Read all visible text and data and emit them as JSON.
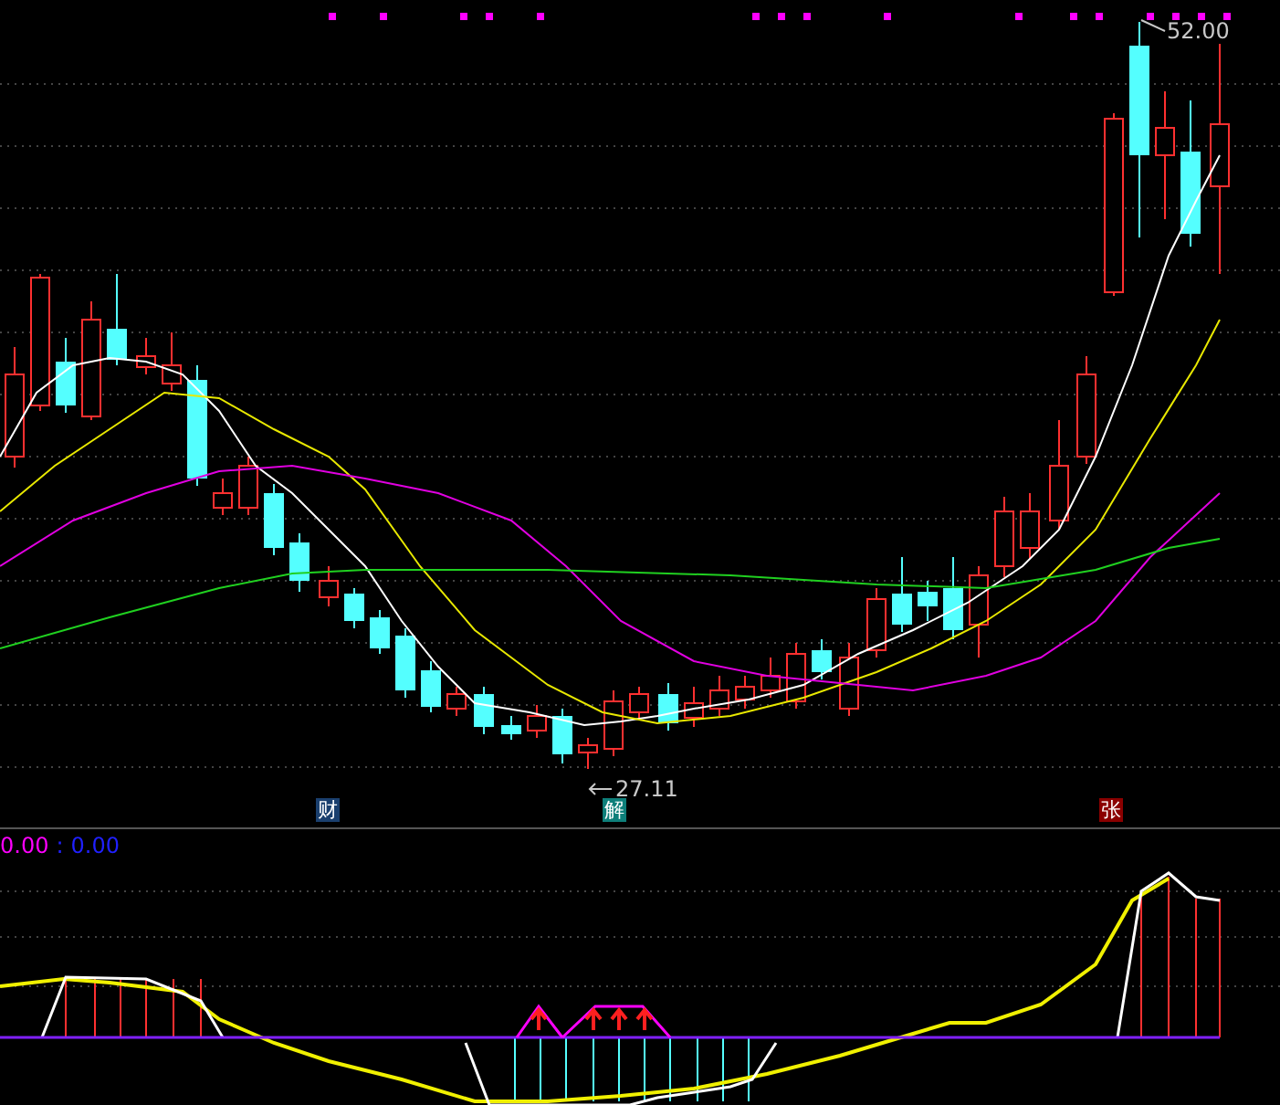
{
  "price_chart": {
    "high_label": "52.00",
    "low_label": "27.11",
    "event_markers": [
      {
        "label": "财",
        "color": "#1a3f6e"
      },
      {
        "label": "解",
        "color": "#0e7f7a"
      },
      {
        "label": "张",
        "color": "#8b0000"
      }
    ]
  },
  "indicator": {
    "values": [
      {
        "text": "0.00",
        "color": "#ff00ff"
      },
      {
        "text": ":",
        "color": "#2020ff"
      },
      {
        "text": "0.00",
        "color": "#2020ff"
      }
    ]
  }
}
